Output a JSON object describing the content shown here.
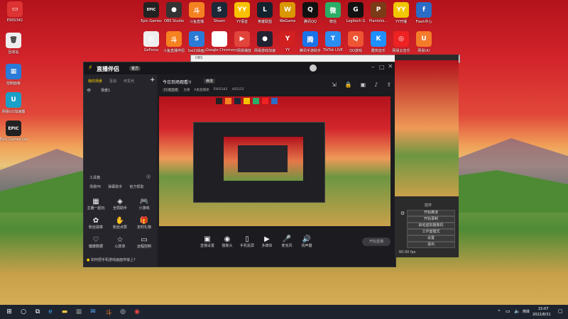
{
  "desktop": {
    "top_icons": [
      {
        "label": "Epic Games",
        "glyph": "EPIC",
        "color": "#222"
      },
      {
        "label": "OBS Studio",
        "glyph": "●",
        "color": "#333"
      },
      {
        "label": "斗鱼直播",
        "glyph": "斗",
        "color": "#f58220"
      },
      {
        "label": "Steam",
        "glyph": "S",
        "color": "#1b2838"
      },
      {
        "label": "YY语音",
        "glyph": "YY",
        "color": "#f8c200"
      },
      {
        "label": "英雄联盟",
        "glyph": "L",
        "color": "#13232e"
      },
      {
        "label": "WeGame",
        "glyph": "W",
        "color": "#d99800"
      },
      {
        "label": "腾讯QQ",
        "glyph": "Q",
        "color": "#111"
      },
      {
        "label": "微信",
        "glyph": "微",
        "color": "#2aae67"
      },
      {
        "label": "Logitech G",
        "glyph": "G",
        "color": "#111"
      },
      {
        "label": "PlantsVs...",
        "glyph": "P",
        "color": "#7a3b16"
      },
      {
        "label": "YY开播",
        "glyph": "YY",
        "color": "#f1c700"
      },
      {
        "label": "Flash中心",
        "glyph": "f",
        "color": "#2b6cc4"
      }
    ],
    "row2_icons": [
      {
        "label": "GeForce",
        "glyph": "▤",
        "color": "#eee"
      },
      {
        "label": "斗鱼直播伴侣",
        "glyph": "斗",
        "color": "#f58220"
      },
      {
        "label": "Sai2(绘画)",
        "glyph": "S",
        "color": "#2a7ad8"
      },
      {
        "label": "Google Chrome",
        "glyph": "◉",
        "color": "#fff"
      },
      {
        "label": "YY网易播放",
        "glyph": "▶",
        "color": "#e0443a"
      },
      {
        "label": "网易游戏加速",
        "glyph": "●",
        "color": "#223"
      },
      {
        "label": "YY",
        "glyph": "Y",
        "color": "#d21f1f"
      },
      {
        "label": "腾讯手游助手",
        "glyph": "腾",
        "color": "#1a73e8"
      },
      {
        "label": "TikTok LIVE",
        "glyph": "T",
        "color": "#2a8df0"
      },
      {
        "label": "QQ游戏",
        "glyph": "Q",
        "color": "#e53"
      },
      {
        "label": "酷狗音乐",
        "glyph": "K",
        "color": "#1e90ff"
      },
      {
        "label": "网易云音乐",
        "glyph": "◎",
        "color": "#e22"
      },
      {
        "label": "网易UU",
        "glyph": "U",
        "color": "#f47b2a"
      }
    ],
    "left_icons": [
      {
        "label": "E90S342",
        "glyph": "▭",
        "color": "#d33"
      },
      {
        "label": "回收站",
        "glyph": "🗑",
        "color": "#ddd"
      },
      {
        "label": "控制面板",
        "glyph": "▦",
        "color": "#2a7ad8"
      },
      {
        "label": "网易UU加速器",
        "glyph": "U",
        "color": "#1aa0c8"
      },
      {
        "label": "Epic Games Launcher",
        "glyph": "EPIC",
        "color": "#222"
      }
    ]
  },
  "app": {
    "logo": "直播伴侣",
    "badge": "官方",
    "sidebar_tabs": [
      "我的场景",
      "互动",
      "可见光"
    ],
    "scene_label": "场景1",
    "toolbox_label": "工具箱",
    "toolbox_tabs": [
      "场景PK",
      "弹幕助手",
      "官方帮助"
    ],
    "tools": [
      {
        "label": "主播一起玩",
        "icon": "▦"
      },
      {
        "label": "全局助手",
        "icon": "◈"
      },
      {
        "label": "小游戏",
        "icon": "🎮"
      },
      {
        "label": "粉丝勋章",
        "icon": "✿"
      },
      {
        "label": "粉丝点赞",
        "icon": "✋"
      },
      {
        "label": "定时礼物",
        "icon": "🎁"
      },
      {
        "label": "健康数据",
        "icon": "♡"
      },
      {
        "label": "心愿单",
        "icon": "☆"
      },
      {
        "label": "远程控制",
        "icon": "▭"
      }
    ],
    "stream_title": "今日到场观看!!",
    "title_tag": "修改",
    "stream_meta": [
      "PC端直播",
      "主播",
      "A类直播源",
      "E90S342",
      "405252"
    ],
    "controls": [
      {
        "label": "直播设置",
        "icon": "▣"
      },
      {
        "label": "摄像头",
        "icon": "◉"
      },
      {
        "label": "手机投屏",
        "icon": "▯"
      },
      {
        "label": "多媒体",
        "icon": "▶"
      },
      {
        "label": "麦克风",
        "icon": "🎤"
      },
      {
        "label": "扬声器",
        "icon": "🔊"
      }
    ],
    "start_button": "开始直播",
    "notice": "如何把手机游戏画面传输上?"
  },
  "panel": {
    "section_label": "控件",
    "buttons": [
      "开始推流",
      "开始录制",
      "启动虚拟摄像机",
      "工作室模式",
      "设置",
      "退出"
    ],
    "fps": "60.00 fps"
  },
  "taskbar": {
    "ime": "简体",
    "time": "15:07",
    "date": "2022/8/31"
  }
}
